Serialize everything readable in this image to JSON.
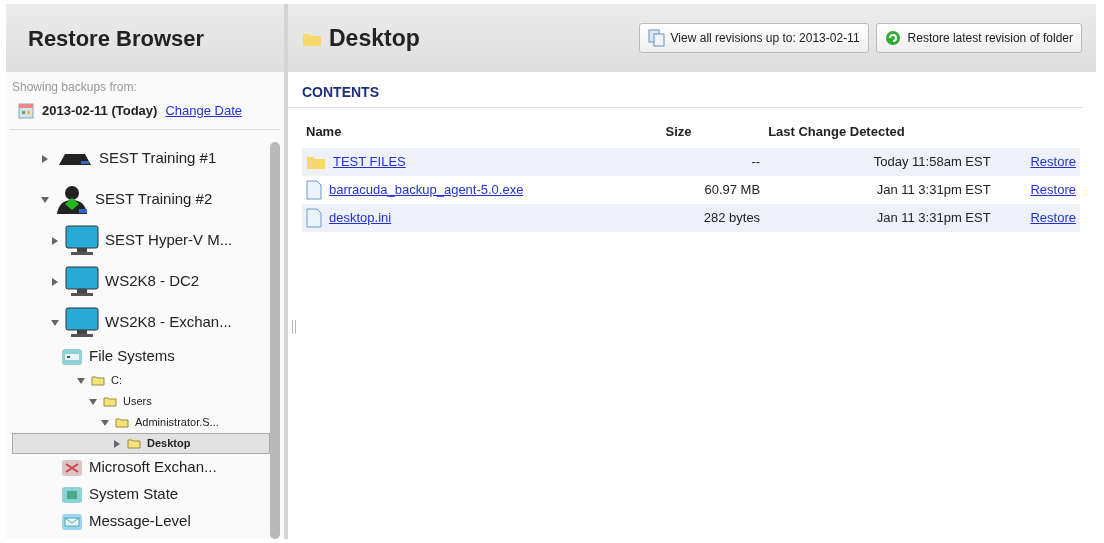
{
  "sidebar": {
    "title": "Restore Browser",
    "showing_label": "Showing backups from:",
    "date": "2013-02-11 (Today)",
    "change_date_link": "Change Date",
    "tree": [
      {
        "label": "SEST Training #1",
        "kind": "appliance",
        "expanded": false,
        "selected": false
      },
      {
        "label": "SEST Training #2",
        "kind": "agent",
        "expanded": true,
        "selected": false,
        "children": [
          {
            "label": "SEST Hyper-V M...",
            "kind": "computer",
            "expanded": false,
            "selected": false
          },
          {
            "label": "WS2K8 - DC2",
            "kind": "computer",
            "expanded": false,
            "selected": false
          },
          {
            "label": "WS2K8 - Exchan...",
            "kind": "computer",
            "expanded": true,
            "selected": false,
            "children": [
              {
                "label": "File Systems",
                "kind": "filesystems",
                "selected": false,
                "children": [
                  {
                    "label": "C:",
                    "kind": "folder",
                    "expanded": true,
                    "selected": false,
                    "children": [
                      {
                        "label": "Users",
                        "kind": "folder",
                        "expanded": true,
                        "selected": false,
                        "children": [
                          {
                            "label": "Administrator.S...",
                            "kind": "folder",
                            "expanded": true,
                            "selected": false,
                            "children": [
                              {
                                "label": "Desktop",
                                "kind": "folder",
                                "expanded": false,
                                "selected": true
                              }
                            ]
                          }
                        ]
                      }
                    ]
                  }
                ]
              },
              {
                "label": "Microsoft Exchan...",
                "kind": "exchange",
                "selected": false
              },
              {
                "label": "System State",
                "kind": "systemstate",
                "selected": false
              },
              {
                "label": "Message-Level",
                "kind": "message",
                "selected": false
              }
            ]
          }
        ]
      }
    ]
  },
  "main": {
    "title": "Desktop",
    "buttons": [
      {
        "label": "View all revisions up to: 2013-02-11",
        "kind": "revisions"
      },
      {
        "label": "Restore latest revision of folder",
        "kind": "restore"
      }
    ],
    "section_title": "CONTENTS",
    "table": {
      "columns": [
        "Name",
        "Size",
        "Last Change Detected"
      ],
      "rows": [
        {
          "kind": "folder",
          "name": "TEST FILES",
          "size": "--",
          "changed": "Today 11:58am EST",
          "action": "Restore"
        },
        {
          "kind": "file",
          "name": "barracuda_backup_agent-5.0.exe",
          "size": "60.97 MB",
          "changed": "Jan 11 3:31pm EST",
          "action": "Restore"
        },
        {
          "kind": "file",
          "name": "desktop.ini",
          "size": "282 bytes",
          "changed": "Jan 11 3:31pm EST",
          "action": "Restore"
        }
      ]
    }
  }
}
